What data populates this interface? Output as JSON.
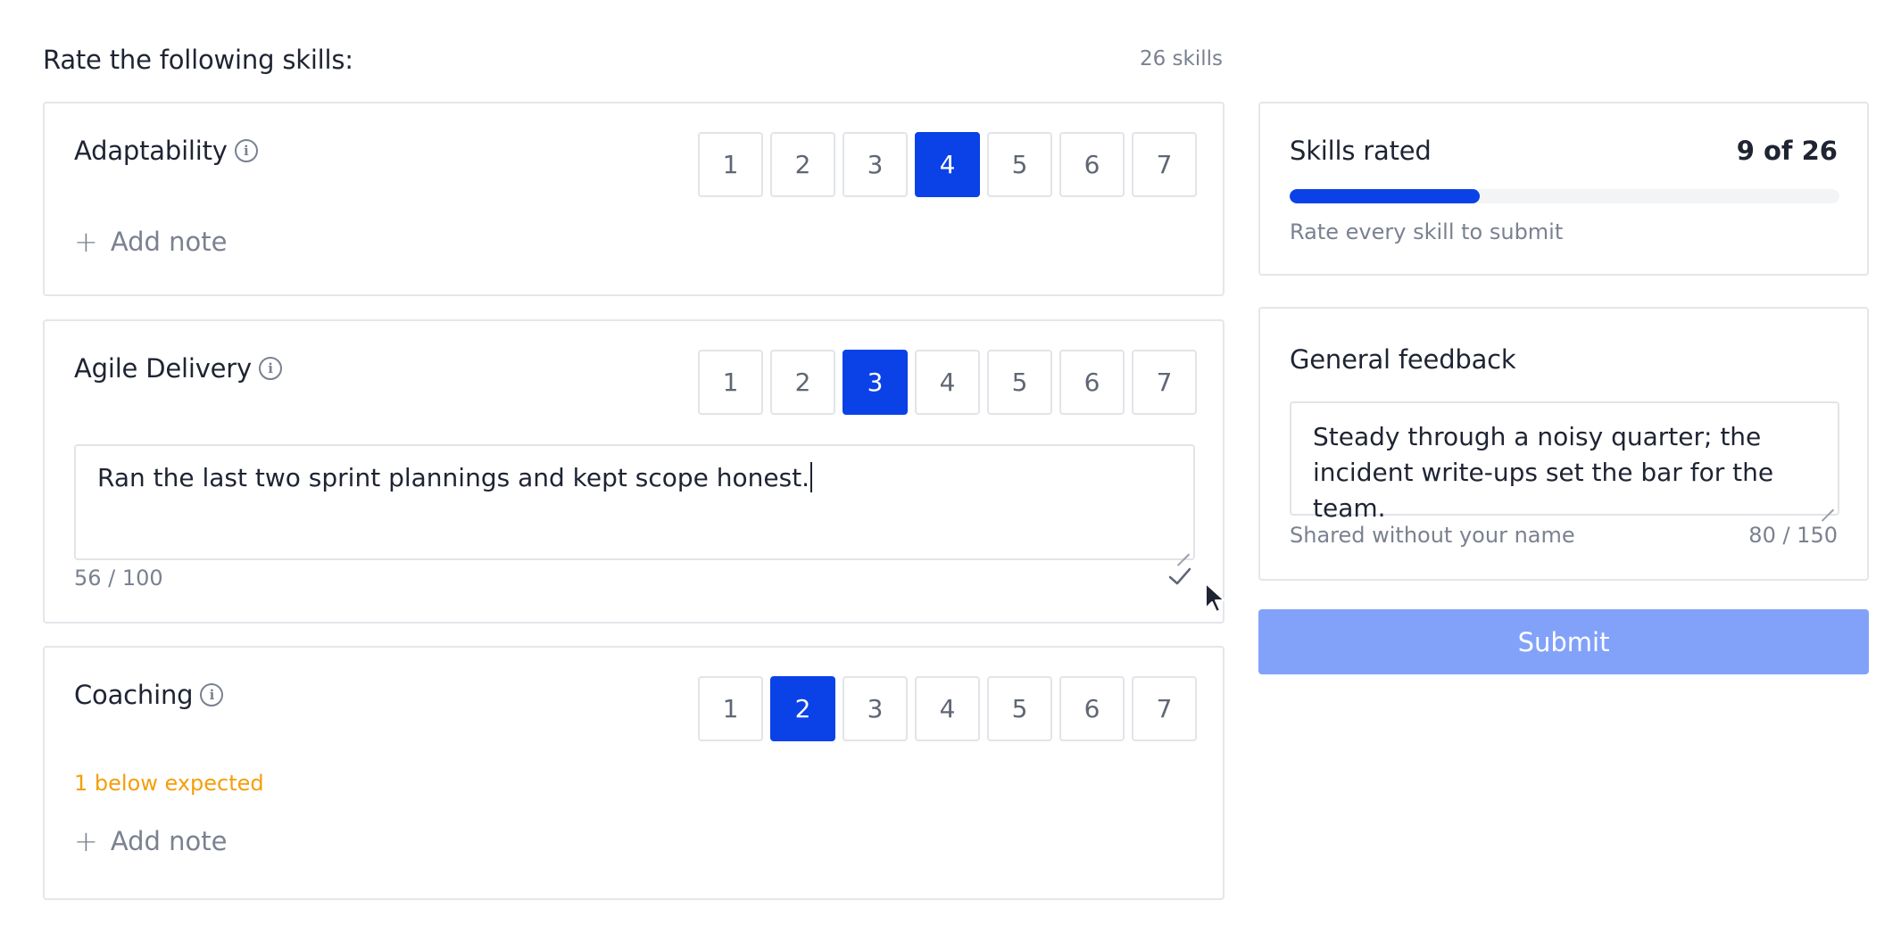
{
  "header": {
    "title": "Rate the following skills:",
    "count": "26 skills"
  },
  "scale_labels": [
    "1",
    "2",
    "3",
    "4",
    "5",
    "6",
    "7"
  ],
  "skills": [
    {
      "name": "Adaptability",
      "selected": 4,
      "add_note_label": "Add note"
    },
    {
      "name": "Agile Delivery",
      "selected": 3,
      "note": "Ran the last two sprint plannings and kept scope honest.",
      "note_counter": "56 / 100"
    },
    {
      "name": "Coaching",
      "selected": 2,
      "warning": "1 below expected",
      "add_note_label": "Add note"
    }
  ],
  "progress": {
    "title": "Skills rated",
    "value": "9 of 26",
    "rated": 9,
    "total": 26,
    "hint": "Rate every skill to submit"
  },
  "feedback": {
    "title": "General feedback",
    "text": "Steady through a noisy quarter; the incident write-ups set the bar for the team.",
    "hint": "Shared without your name",
    "counter": "80 / 150"
  },
  "submit_label": "Submit",
  "colors": {
    "accent": "#0a42e8",
    "submit_disabled": "#82a2fa",
    "warning": "#f59e0b"
  }
}
